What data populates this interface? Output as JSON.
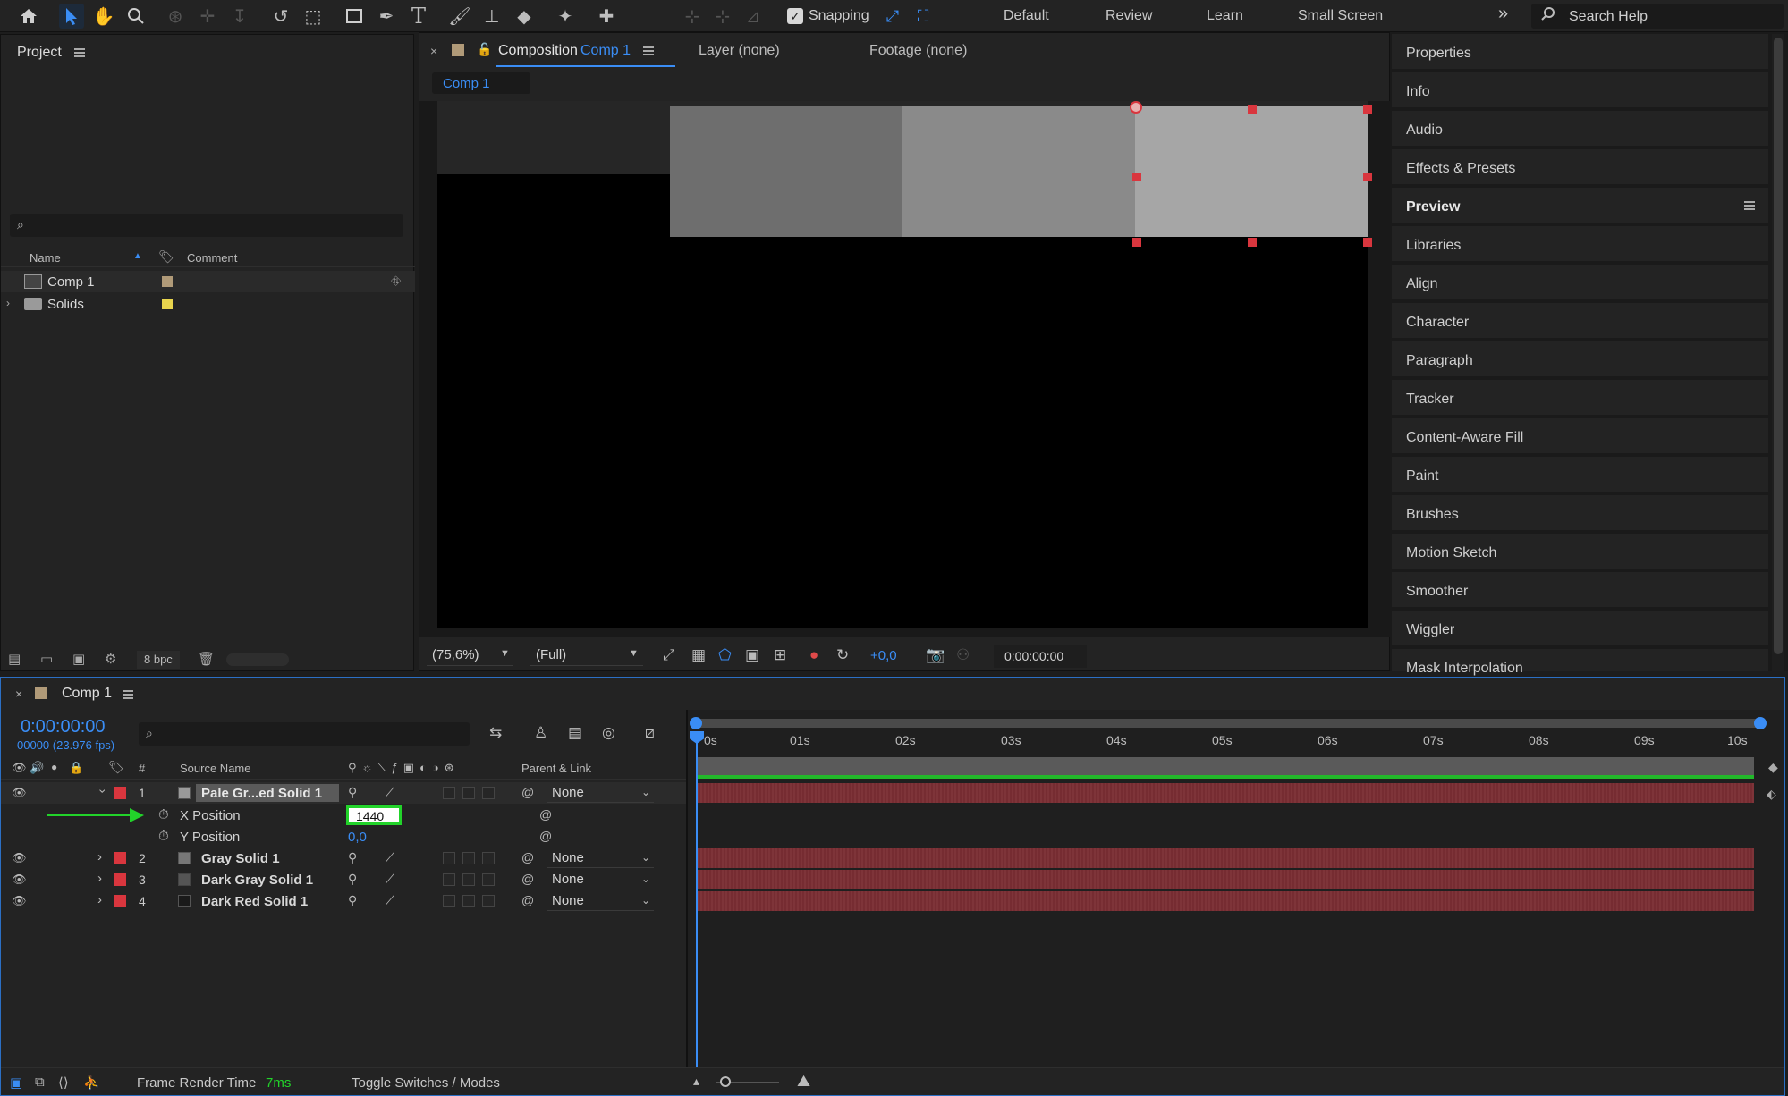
{
  "toolbar": {
    "snapping_label": "Snapping",
    "workspaces": [
      "Default",
      "Review",
      "Learn",
      "Small Screen"
    ],
    "more": "»",
    "search_placeholder": "Search Help",
    "accent": "#3a8df5"
  },
  "project": {
    "title": "Project",
    "col_name": "Name",
    "col_comment": "Comment",
    "items": [
      {
        "label": "Comp 1",
        "color": "#b09a78",
        "icon": "composition-icon"
      },
      {
        "label": "Solids",
        "color": "#e8d44d",
        "icon": "folder-icon"
      }
    ],
    "bpc": "8 bpc"
  },
  "composition": {
    "close": "×",
    "prefix": "Composition",
    "name": "Comp 1",
    "layer_tab": "Layer (none)",
    "footage_tab": "Footage (none)",
    "sub_tab": "Comp 1",
    "zoom": "(75,6%)",
    "resolution": "(Full)",
    "exposure": "+0,0",
    "timecode": "0:00:00:00"
  },
  "right_panels": [
    {
      "label": "Properties",
      "bold": false
    },
    {
      "label": "Info",
      "bold": false
    },
    {
      "label": "Audio",
      "bold": false
    },
    {
      "label": "Effects & Presets",
      "bold": false
    },
    {
      "label": "Preview",
      "bold": true
    },
    {
      "label": "Libraries",
      "bold": false
    },
    {
      "label": "Align",
      "bold": false
    },
    {
      "label": "Character",
      "bold": false
    },
    {
      "label": "Paragraph",
      "bold": false
    },
    {
      "label": "Tracker",
      "bold": false
    },
    {
      "label": "Content-Aware Fill",
      "bold": false
    },
    {
      "label": "Paint",
      "bold": false
    },
    {
      "label": "Brushes",
      "bold": false
    },
    {
      "label": "Motion Sketch",
      "bold": false
    },
    {
      "label": "Smoother",
      "bold": false
    },
    {
      "label": "Wiggler",
      "bold": false
    },
    {
      "label": "Mask Interpolation",
      "bold": false
    }
  ],
  "timeline": {
    "close": "×",
    "comp_name": "Comp 1",
    "timecode": "0:00:00:00",
    "frame_info": "00000 (23.976 fps)",
    "col_num": "#",
    "col_source": "Source Name",
    "col_parent": "Parent & Link",
    "ticks": [
      "0s",
      "01s",
      "02s",
      "03s",
      "04s",
      "05s",
      "06s",
      "07s",
      "08s",
      "09s",
      "10s"
    ],
    "layers": [
      {
        "num": "1",
        "name": "Pale Gr...ed Solid 1",
        "parent": "None",
        "swatch": "#9a9a9a",
        "expanded": true
      },
      {
        "num": "2",
        "name": "Gray Solid 1",
        "parent": "None",
        "swatch": "#777777",
        "expanded": false
      },
      {
        "num": "3",
        "name": "Dark Gray Solid 1",
        "parent": "None",
        "swatch": "#555555",
        "expanded": false
      },
      {
        "num": "4",
        "name": "Dark Red Solid 1",
        "parent": "None",
        "swatch": "#1a1a1a",
        "expanded": false
      }
    ],
    "props": [
      {
        "label": "X Position",
        "value": "1440"
      },
      {
        "label": "Y Position",
        "value": "0,0"
      }
    ],
    "frame_render_label": "Frame Render Time",
    "frame_render_value": "7ms",
    "toggle_label": "Toggle Switches / Modes",
    "label_color": "#d9363e",
    "bar_color": "#7a2d33",
    "highlight_color": "#22d32a"
  }
}
